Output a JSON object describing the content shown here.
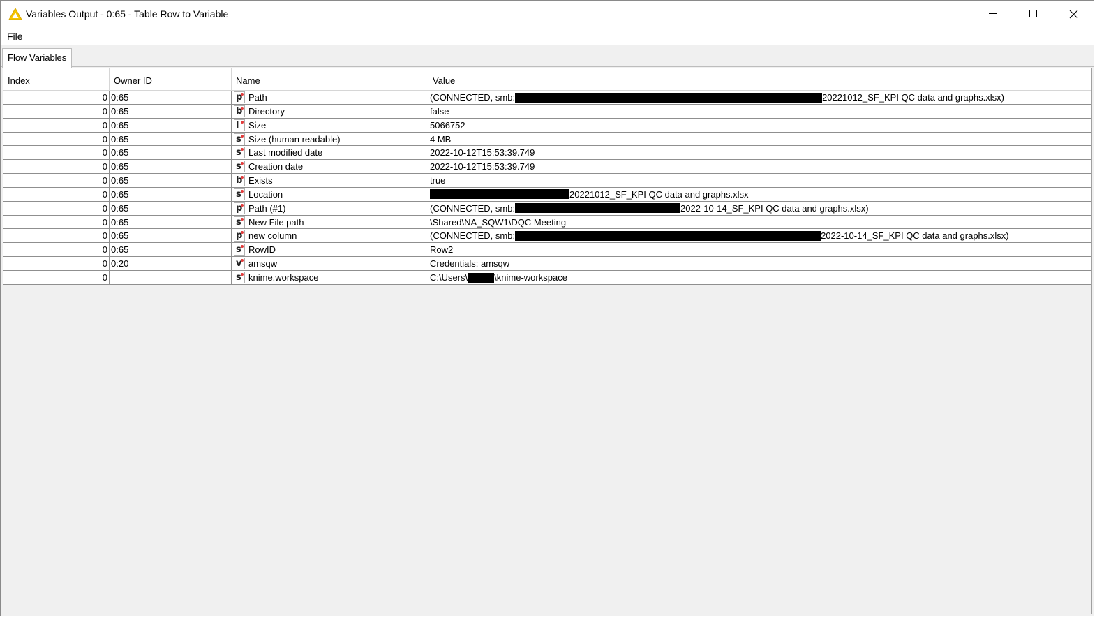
{
  "window": {
    "title": "Variables Output - 0:65 - Table Row to Variable",
    "controls": [
      "minimize-icon",
      "maximize-icon",
      "close-icon"
    ]
  },
  "menu": {
    "file": "File"
  },
  "tabs": [
    {
      "label": "Flow Variables",
      "active": true
    }
  ],
  "table": {
    "columns": [
      "Index",
      "Owner ID",
      "Name",
      "Value"
    ],
    "rows": [
      {
        "index": "0",
        "owner": "0:65",
        "type": "p",
        "name": "Path",
        "value_pre": "(CONNECTED, smb:",
        "redacted": true,
        "value_post": "20221012_SF_KPI QC data and graphs.xlsx)"
      },
      {
        "index": "0",
        "owner": "0:65",
        "type": "b",
        "name": "Directory",
        "value_pre": "false",
        "redacted": false,
        "value_post": ""
      },
      {
        "index": "0",
        "owner": "0:65",
        "type": "l",
        "name": "Size",
        "value_pre": "5066752",
        "redacted": false,
        "value_post": ""
      },
      {
        "index": "0",
        "owner": "0:65",
        "type": "s",
        "name": "Size (human readable)",
        "value_pre": "4 MB",
        "redacted": false,
        "value_post": ""
      },
      {
        "index": "0",
        "owner": "0:65",
        "type": "s",
        "name": "Last modified date",
        "value_pre": "2022-10-12T15:53:39.749",
        "redacted": false,
        "value_post": ""
      },
      {
        "index": "0",
        "owner": "0:65",
        "type": "s",
        "name": "Creation date",
        "value_pre": "2022-10-12T15:53:39.749",
        "redacted": false,
        "value_post": ""
      },
      {
        "index": "0",
        "owner": "0:65",
        "type": "b",
        "name": "Exists",
        "value_pre": "true",
        "redacted": false,
        "value_post": ""
      },
      {
        "index": "0",
        "owner": "0:65",
        "type": "s",
        "name": "Location",
        "value_pre": "",
        "redacted": true,
        "value_post": "20221012_SF_KPI QC data and graphs.xlsx"
      },
      {
        "index": "0",
        "owner": "0:65",
        "type": "p",
        "name": "Path (#1)",
        "value_pre": "(CONNECTED, smb:",
        "redacted": true,
        "value_post": "2022-10-14_SF_KPI QC data and graphs.xlsx)"
      },
      {
        "index": "0",
        "owner": "0:65",
        "type": "s",
        "name": "New File path",
        "value_pre": "\\Shared\\NA_SQW1\\DQC Meeting",
        "redacted": false,
        "value_post": ""
      },
      {
        "index": "0",
        "owner": "0:65",
        "type": "p",
        "name": "new column",
        "value_pre": "(CONNECTED, smb:",
        "redacted": true,
        "value_post": "2022-10-14_SF_KPI QC data and graphs.xlsx)"
      },
      {
        "index": "0",
        "owner": "0:65",
        "type": "s",
        "name": "RowID",
        "value_pre": "Row2",
        "redacted": false,
        "value_post": ""
      },
      {
        "index": "0",
        "owner": "0:20",
        "type": "v",
        "name": "amsqw",
        "value_pre": "Credentials: amsqw",
        "redacted": false,
        "value_post": ""
      },
      {
        "index": "0",
        "owner": "",
        "type": "s",
        "name": "knime.workspace",
        "value_pre": "C:\\Users\\",
        "redacted": true,
        "value_post": "\\knime-workspace"
      }
    ]
  },
  "colors": {
    "type_dot": "#e23b3b",
    "warning_icon": "#f5c400",
    "redaction": "#000000"
  }
}
